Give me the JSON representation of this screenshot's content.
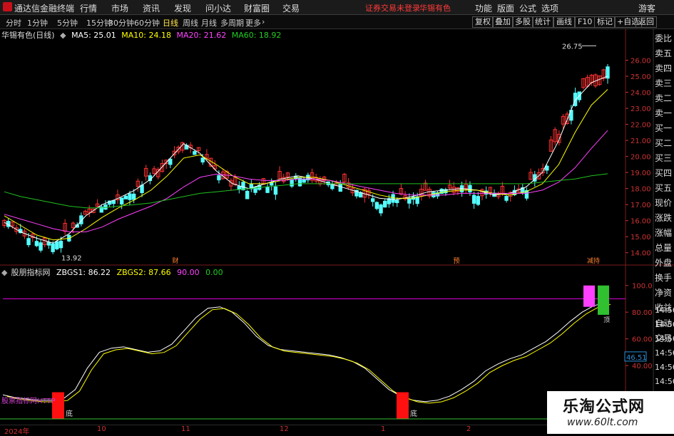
{
  "menubar": {
    "app_title": "通达信金融终端",
    "menus": [
      "行情",
      "市场",
      "资讯",
      "发现",
      "问小达",
      "财富圈",
      "交易"
    ],
    "warning": "证券交易未登录",
    "stock": "华锡有色",
    "right_menus": [
      "功能",
      "版面",
      "公式",
      "选项"
    ],
    "guest": "游客"
  },
  "periods": {
    "items": [
      "分时",
      "1分钟",
      "5分钟",
      "15分钟",
      "30分钟",
      "60分钟",
      "日线",
      "周线",
      "月线",
      "多周期",
      "更多"
    ],
    "active": "日线",
    "tools": [
      "复权",
      "叠加",
      "多股",
      "统计",
      "画线",
      "F10",
      "标记",
      "+自选",
      "返回"
    ]
  },
  "legend": {
    "name": "华锡有色(日线)",
    "ma5": "MA5: 25.01",
    "ma10": "MA10: 24.18",
    "ma20": "MA20: 21.62",
    "ma60": "MA60: 18.92",
    "high_label": "26.75",
    "low_label": "13.92"
  },
  "price_axis": [
    "26.00",
    "25.00",
    "24.00",
    "23.00",
    "22.00",
    "21.00",
    "20.00",
    "19.00",
    "18.00",
    "17.00",
    "16.00",
    "15.00",
    "14.00"
  ],
  "side_panel": [
    "委比",
    "卖五",
    "卖四",
    "卖三",
    "卖二",
    "卖一",
    "买一",
    "买二",
    "买三",
    "买四",
    "买五",
    "现价",
    "涨跌",
    "涨幅",
    "总量",
    "外盘",
    "换手",
    "净资",
    "收益",
    "自动",
    "交易"
  ],
  "markers": [
    "财",
    "预",
    "减持"
  ],
  "indicator": {
    "name": "股朋指标网",
    "zbgs1": "ZBGS1: 86.22",
    "zbgs2": "ZBGS2: 87.66",
    "v1": "90.00",
    "v2": "0.00",
    "axis": [
      "100.0",
      "80.00",
      "60.00",
      "40.00"
    ],
    "current": "46.51",
    "times": [
      "14:56",
      "14:56",
      "14:56",
      "14:56",
      "14:56",
      "14:56",
      "14:56",
      "14:56",
      "14:56"
    ],
    "watermark_text": "股票指标网HTTP",
    "bottom_labels": [
      "底",
      "底"
    ],
    "top_label": "顶"
  },
  "dates": [
    "2024年",
    "10",
    "11",
    "12",
    "1",
    "2"
  ],
  "watermark": {
    "title": "乐淘公式网",
    "url": "www.60lt.com"
  },
  "colors": {
    "up": "#ff3232",
    "down": "#54ffff",
    "ma5": "#ffffff",
    "ma10": "#ffff00",
    "ma20": "#ff40ff",
    "ma60": "#20c020",
    "indicator_line": "#cc00cc"
  },
  "chart_data": {
    "type": "line",
    "title": "华锡有色(日线)",
    "ylim": [
      13.5,
      27.0
    ],
    "series": [
      {
        "name": "MA5",
        "values": [
          15.9,
          15.3,
          14.9,
          14.6,
          15.2,
          16.3,
          17.0,
          17.4,
          17.9,
          18.6,
          19.7,
          20.8,
          20.2,
          19.1,
          18.3,
          18.0,
          18.3,
          18.6,
          18.8,
          18.6,
          18.3,
          18.0,
          17.7,
          17.4,
          17.3,
          17.5,
          17.8,
          17.9,
          18.0,
          17.9,
          17.6,
          17.7,
          18.1,
          19.0,
          21.0,
          23.5,
          24.6,
          25.01
        ]
      },
      {
        "name": "MA10",
        "values": [
          16.3,
          15.7,
          15.1,
          14.8,
          14.9,
          15.5,
          16.2,
          16.8,
          17.3,
          17.9,
          18.8,
          19.9,
          20.1,
          19.5,
          18.8,
          18.3,
          18.3,
          18.5,
          18.7,
          18.7,
          18.5,
          18.2,
          17.9,
          17.6,
          17.4,
          17.4,
          17.6,
          17.8,
          17.9,
          17.9,
          17.7,
          17.6,
          17.8,
          18.3,
          19.5,
          21.5,
          23.2,
          24.18
        ]
      },
      {
        "name": "MA20",
        "values": [
          16.4,
          16.1,
          15.8,
          15.5,
          15.3,
          15.3,
          15.6,
          16.1,
          16.5,
          16.9,
          17.4,
          18.1,
          18.7,
          18.9,
          18.8,
          18.6,
          18.5,
          18.5,
          18.6,
          18.6,
          18.5,
          18.3,
          18.1,
          17.9,
          17.7,
          17.6,
          17.6,
          17.6,
          17.7,
          17.7,
          17.7,
          17.7,
          17.7,
          17.9,
          18.4,
          19.3,
          20.5,
          21.62
        ]
      },
      {
        "name": "MA60",
        "values": [
          17.8,
          17.5,
          17.3,
          17.1,
          16.9,
          16.8,
          16.8,
          16.9,
          17.0,
          17.1,
          17.3,
          17.5,
          17.7,
          17.8,
          17.9,
          18.0,
          18.1,
          18.2,
          18.3,
          18.3,
          18.3,
          18.3,
          18.3,
          18.3,
          18.3,
          18.3,
          18.3,
          18.3,
          18.3,
          18.3,
          18.3,
          18.3,
          18.3,
          18.4,
          18.5,
          18.6,
          18.8,
          18.92
        ]
      }
    ]
  }
}
